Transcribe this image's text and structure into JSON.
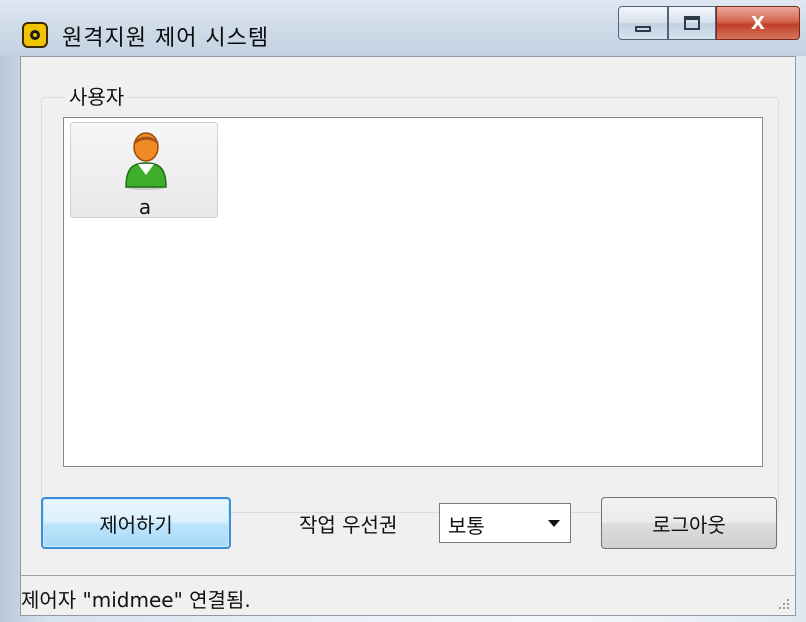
{
  "window": {
    "title": "원격지원 제어 시스템",
    "caption": {
      "minimize_icon": "minimize-icon",
      "maximize_icon": "maximize-icon",
      "close_label": "X"
    }
  },
  "users_group": {
    "label": "사용자",
    "items": [
      {
        "name": "a",
        "icon": "user-icon"
      }
    ]
  },
  "actions": {
    "control_label": "제어하기",
    "priority_label": "작업 우선권",
    "priority_value": "보통",
    "logout_label": "로그아웃"
  },
  "status": {
    "text": "제어자 \"midmee\" 연결됨."
  },
  "colors": {
    "focus_border": "#3c8ed6",
    "close_button": "#c0402a",
    "user_shirt": "#3fae2c",
    "user_head": "#f08a24"
  }
}
